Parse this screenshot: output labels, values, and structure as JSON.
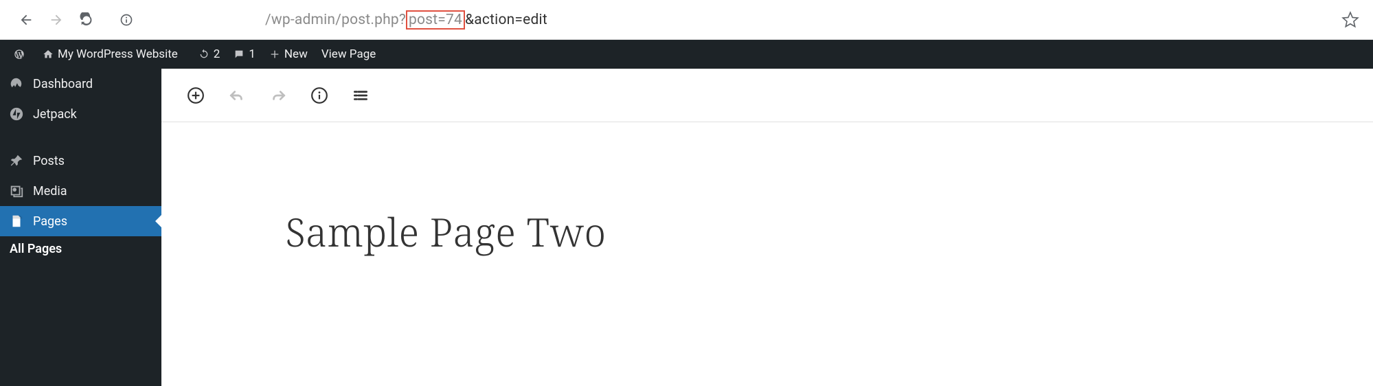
{
  "browser": {
    "url_prefix": "/wp-admin/post.php?",
    "url_highlight": "post=74",
    "url_suffix": "&action=edit"
  },
  "adminbar": {
    "site_title": "My WordPress Website",
    "updates_count": "2",
    "comments_count": "1",
    "new_label": "New",
    "view_label": "View Page"
  },
  "sidebar": {
    "dashboard": "Dashboard",
    "jetpack": "Jetpack",
    "posts": "Posts",
    "media": "Media",
    "pages": "Pages",
    "all_pages": "All Pages"
  },
  "editor": {
    "page_title": "Sample Page Two"
  }
}
